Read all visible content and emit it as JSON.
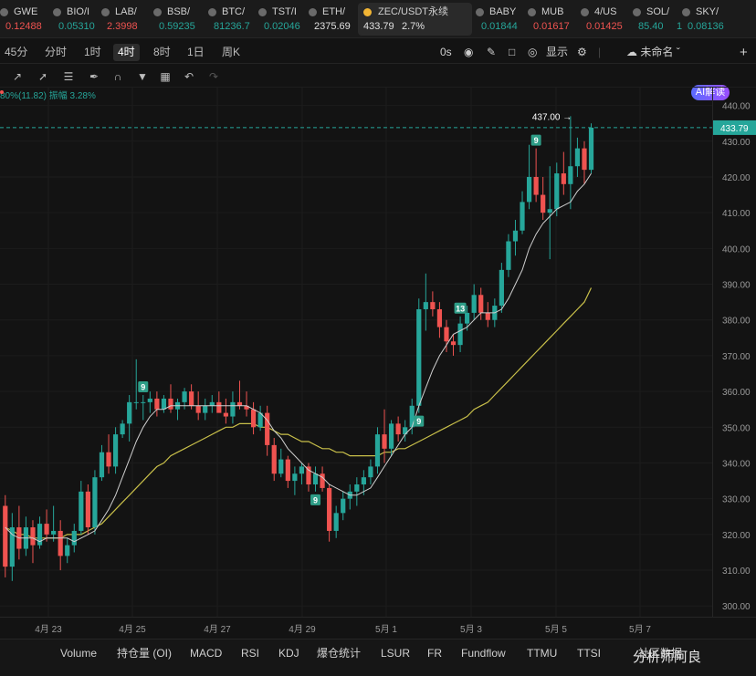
{
  "colors": {
    "up": "#26a69a",
    "down": "#ef5350",
    "ma_short": "#cfcfcf",
    "ma_long": "#c9c04a",
    "current_price_line": "#26a69a"
  },
  "ticker": [
    {
      "symbol": "GWE",
      "price": "0.12488",
      "dir": "down"
    },
    {
      "symbol": "BIO/I",
      "price": "0.05310",
      "dir": "up"
    },
    {
      "symbol": "LAB/",
      "price": "2.3998",
      "dir": "down"
    },
    {
      "symbol": "BSB/",
      "price": "0.59235",
      "dir": "up"
    },
    {
      "symbol": "BTC/",
      "price": "81236.7",
      "dir": "up"
    },
    {
      "symbol": "TST/I",
      "price": "0.02046",
      "dir": "up"
    },
    {
      "symbol": "ETH/",
      "price": "2375.69",
      "dir": "flat"
    },
    {
      "symbol": "ZEC/USDT永续",
      "price": "433.79",
      "change": "2.7%",
      "dir": "up",
      "active": true
    },
    {
      "symbol": "BABY",
      "price": "0.01844",
      "dir": "up"
    },
    {
      "symbol": "MUB",
      "price": "0.01617",
      "dir": "down"
    },
    {
      "symbol": "4/US",
      "price": "0.01425",
      "dir": "down"
    },
    {
      "symbol": "SOL/",
      "price": "85.40",
      "change": "1",
      "dir": "up"
    },
    {
      "symbol": "SKY/",
      "price": "0.08136",
      "dir": "up"
    }
  ],
  "timeframes": [
    "45分",
    "分时",
    "1时",
    "4时",
    "8时",
    "1日",
    "周K"
  ],
  "selected_timeframe": "4时",
  "toolbar_right": {
    "countdown": "0s",
    "display": "显示",
    "layout_name": "未命名",
    "ai": "AI解读"
  },
  "info_line": "80%(11.82)  振幅 3.28%",
  "price_axis": {
    "labels": [
      "440.00",
      "430.00",
      "420.00",
      "410.00",
      "400.00",
      "390.00",
      "380.00",
      "370.00",
      "360.00",
      "350.00",
      "340.00",
      "330.00",
      "320.00",
      "310.00",
      "300.00"
    ],
    "current": "433.79"
  },
  "chart_data": {
    "type": "candlestick",
    "symbol": "ZEC/USDT永续",
    "interval": "4时",
    "ylim": [
      297,
      445
    ],
    "high_marker": "437.00",
    "x_labels": [
      "4月 23",
      "4月 25",
      "4月 27",
      "4月 29",
      "5月 1",
      "5月 3",
      "5月 5",
      "5月 7"
    ],
    "candles": [
      [
        328,
        331,
        308,
        311
      ],
      [
        311,
        326,
        307,
        322
      ],
      [
        322,
        328,
        313,
        316
      ],
      [
        316,
        325,
        314,
        322
      ],
      [
        322,
        324,
        312,
        317
      ],
      [
        317,
        325,
        316,
        323
      ],
      [
        323,
        327,
        318,
        320
      ],
      [
        320,
        328,
        318,
        321
      ],
      [
        321,
        324,
        310,
        314
      ],
      [
        314,
        319,
        312,
        317
      ],
      [
        317,
        323,
        315,
        321
      ],
      [
        321,
        335,
        320,
        332
      ],
      [
        332,
        334,
        320,
        322
      ],
      [
        322,
        338,
        320,
        336
      ],
      [
        336,
        345,
        335,
        343
      ],
      [
        343,
        348,
        337,
        339
      ],
      [
        339,
        350,
        337,
        348
      ],
      [
        348,
        352,
        347,
        351
      ],
      [
        351,
        359,
        346,
        357
      ],
      [
        357,
        369,
        355,
        357
      ],
      [
        357,
        359,
        352,
        357
      ],
      [
        357,
        360,
        354,
        358
      ],
      [
        358,
        360,
        353,
        355
      ],
      [
        355,
        359,
        354,
        358
      ],
      [
        358,
        362,
        354,
        355
      ],
      [
        355,
        358,
        352,
        357
      ],
      [
        357,
        361,
        355,
        360
      ],
      [
        360,
        362,
        355,
        356
      ],
      [
        356,
        360,
        352,
        354
      ],
      [
        354,
        358,
        352,
        356
      ],
      [
        356,
        359,
        354,
        357
      ],
      [
        357,
        360,
        355,
        354
      ],
      [
        354,
        358,
        351,
        353
      ],
      [
        353,
        360,
        351,
        357
      ],
      [
        357,
        363,
        355,
        356
      ],
      [
        356,
        360,
        353,
        355
      ],
      [
        355,
        357,
        348,
        350
      ],
      [
        350,
        356,
        349,
        354
      ],
      [
        354,
        356,
        342,
        345
      ],
      [
        345,
        347,
        335,
        337
      ],
      [
        337,
        344,
        336,
        341
      ],
      [
        341,
        342,
        333,
        335
      ],
      [
        335,
        339,
        331,
        337
      ],
      [
        337,
        340,
        334,
        339
      ],
      [
        339,
        340,
        332,
        334
      ],
      [
        334,
        339,
        332,
        337
      ],
      [
        337,
        339,
        332,
        333
      ],
      [
        333,
        334,
        318,
        321
      ],
      [
        321,
        328,
        319,
        326
      ],
      [
        326,
        332,
        324,
        330
      ],
      [
        330,
        334,
        327,
        332
      ],
      [
        332,
        336,
        328,
        334
      ],
      [
        334,
        338,
        331,
        336
      ],
      [
        336,
        341,
        334,
        339
      ],
      [
        339,
        350,
        337,
        348
      ],
      [
        348,
        355,
        340,
        344
      ],
      [
        344,
        352,
        342,
        351
      ],
      [
        351,
        353,
        346,
        348
      ],
      [
        348,
        352,
        346,
        350
      ],
      [
        350,
        358,
        348,
        356
      ],
      [
        356,
        386,
        354,
        383
      ],
      [
        383,
        393,
        377,
        385
      ],
      [
        385,
        388,
        381,
        383
      ],
      [
        383,
        385,
        375,
        378
      ],
      [
        378,
        380,
        371,
        374
      ],
      [
        374,
        376,
        370,
        373
      ],
      [
        373,
        381,
        371,
        379
      ],
      [
        379,
        384,
        377,
        382
      ],
      [
        382,
        390,
        380,
        387
      ],
      [
        387,
        389,
        380,
        382
      ],
      [
        382,
        385,
        378,
        380
      ],
      [
        380,
        386,
        378,
        384
      ],
      [
        384,
        396,
        382,
        394
      ],
      [
        394,
        404,
        392,
        402
      ],
      [
        402,
        408,
        398,
        405
      ],
      [
        405,
        416,
        404,
        413
      ],
      [
        413,
        429,
        411,
        420
      ],
      [
        420,
        428,
        413,
        415
      ],
      [
        415,
        420,
        408,
        410
      ],
      [
        410,
        423,
        397,
        411
      ],
      [
        411,
        424,
        409,
        421
      ],
      [
        421,
        427,
        415,
        418
      ],
      [
        418,
        437,
        411,
        423
      ],
      [
        423,
        431,
        420,
        428
      ],
      [
        428,
        430,
        418,
        422
      ],
      [
        422,
        435,
        421,
        433.79
      ]
    ],
    "ma_short": [
      322,
      320,
      319,
      319,
      319,
      318,
      319,
      319,
      319,
      319,
      318,
      319,
      320,
      321,
      324,
      327,
      331,
      336,
      341,
      346,
      350,
      353,
      355,
      355,
      356,
      356,
      356,
      356,
      356,
      356,
      356,
      356,
      356,
      356,
      356,
      356,
      355,
      354,
      352,
      349,
      347,
      344,
      342,
      340,
      338,
      337,
      336,
      334,
      333,
      332,
      331,
      331,
      332,
      333,
      336,
      339,
      342,
      345,
      348,
      350,
      356,
      361,
      366,
      370,
      373,
      376,
      377,
      378,
      380,
      382,
      382,
      382,
      383,
      386,
      390,
      394,
      400,
      404,
      407,
      409,
      411,
      412,
      413,
      416,
      418,
      421
    ],
    "ma_long": [
      322,
      321,
      320,
      320,
      319,
      319,
      319,
      319,
      319,
      320,
      320,
      320,
      321,
      322,
      323,
      325,
      327,
      329,
      331,
      333,
      335,
      337,
      339,
      340,
      342,
      343,
      344,
      345,
      346,
      347,
      348,
      349,
      350,
      350,
      351,
      351,
      351,
      350,
      350,
      349,
      348,
      348,
      347,
      346,
      346,
      345,
      344,
      344,
      343,
      343,
      342,
      342,
      342,
      342,
      342,
      343,
      343,
      344,
      344,
      345,
      346,
      347,
      348,
      349,
      350,
      351,
      352,
      353,
      355,
      356,
      357,
      359,
      361,
      363,
      365,
      367,
      369,
      371,
      373,
      375,
      377,
      379,
      381,
      383,
      385,
      389
    ],
    "markers": [
      {
        "i": 20,
        "label": "9",
        "pos": "above"
      },
      {
        "i": 45,
        "label": "9",
        "pos": "below"
      },
      {
        "i": 60,
        "label": "9",
        "pos": "below"
      },
      {
        "i": 66,
        "label": "13",
        "pos": "above"
      },
      {
        "i": 77,
        "label": "9",
        "pos": "above"
      }
    ]
  },
  "indicators": [
    "Volume",
    "持仓量 (OI)",
    "MACD",
    "RSI",
    "KDJ",
    "爆仓统计",
    "LSUR",
    "FR",
    "Fundflow",
    "TTMU",
    "TTSI",
    "社区数据"
  ],
  "watermark": "分析师阿良"
}
